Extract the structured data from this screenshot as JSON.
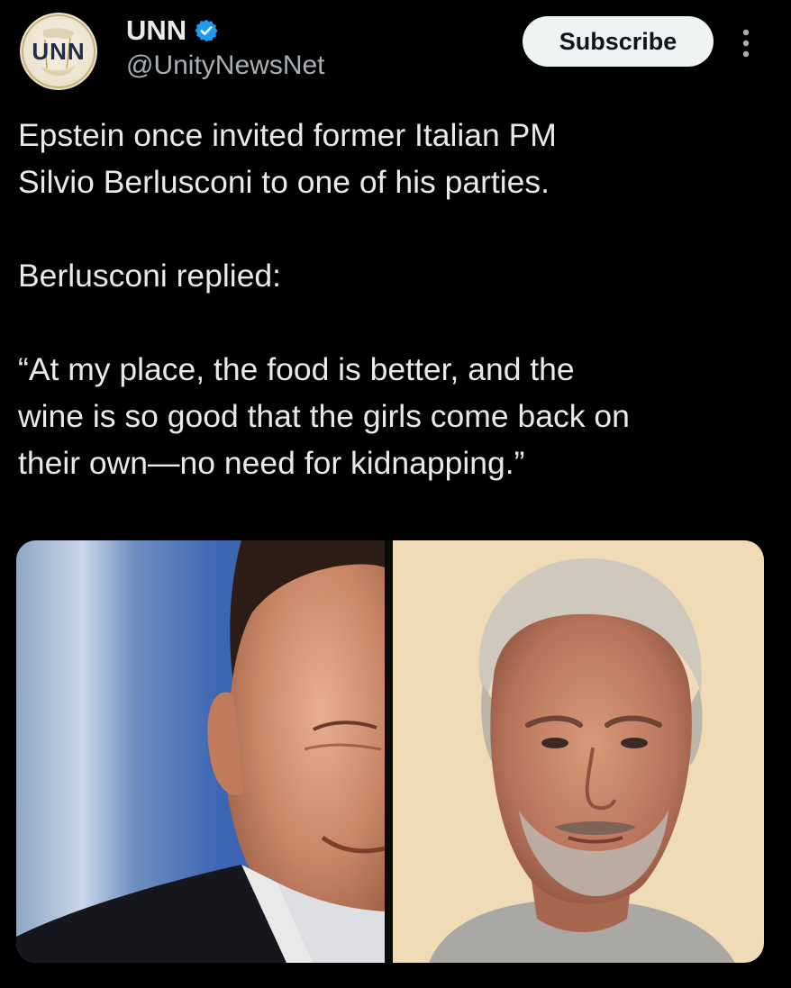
{
  "post": {
    "author": {
      "display_name": "UNN",
      "handle": "@UnityNewsNet",
      "avatar_text": "UNN",
      "verified": true,
      "verified_color": "#1d9bf0"
    },
    "subscribe_label": "Subscribe",
    "more_icon": "vertical-ellipsis-icon",
    "text": {
      "p1_line1": "Epstein once invited former Italian PM",
      "p1_line2": "Silvio Berlusconi to one of his parties.",
      "p2": "Berlusconi replied:",
      "p3_line1": "“At my place, the food is better, and the",
      "p3_line2": "wine is so good that the girls come back on",
      "p3_line3": "their own—no need for kidnapping.”"
    },
    "media": {
      "photo_count": 2
    }
  },
  "colors": {
    "background": "#000000",
    "text_primary": "#e7e9ea",
    "text_secondary": "#a9aeb3",
    "button_bg": "#eff3f4"
  }
}
